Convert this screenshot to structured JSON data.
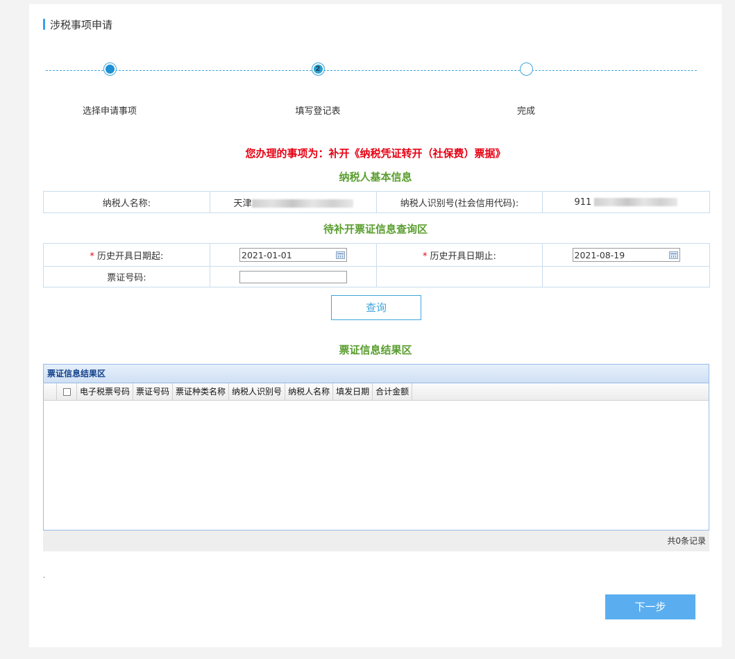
{
  "page": {
    "title": "涉税事项申请"
  },
  "steps": [
    {
      "label": "选择申请事项",
      "state": "done"
    },
    {
      "label": "填写登记表",
      "state": "current",
      "number": "2"
    },
    {
      "label": "完成",
      "state": "todo"
    }
  ],
  "notice": "您办理的事项为：补开《纳税凭证转开（社保费）票据》",
  "taxpayer_section": {
    "title": "纳税人基本信息",
    "name_label": "纳税人名称:",
    "name_value": "天津",
    "id_label": "纳税人识别号(社会信用代码):",
    "id_value": "911"
  },
  "query_section": {
    "title": "待补开票证信息查询区",
    "required_mark": "*",
    "start_label": "历史开具日期起:",
    "start_value": "2021-01-01",
    "end_label": "历史开具日期止:",
    "end_value": "2021-08-19",
    "ticket_label": "票证号码:",
    "ticket_value": "",
    "query_button": "查询"
  },
  "result_section": {
    "title": "票证信息结果区",
    "panel_title": "票证信息结果区",
    "columns": [
      "电子税票号码",
      "票证号码",
      "票证种类名称",
      "纳税人识别号",
      "纳税人名称",
      "填发日期",
      "合计金额"
    ],
    "rows": [],
    "record_count": "共0条记录"
  },
  "footer": {
    "dot": ".",
    "next_button": "下一步"
  },
  "colors": {
    "accent": "#3ea5db",
    "notice": "#e60012",
    "section": "#5a9e2f",
    "next_button": "#5aaef0"
  }
}
